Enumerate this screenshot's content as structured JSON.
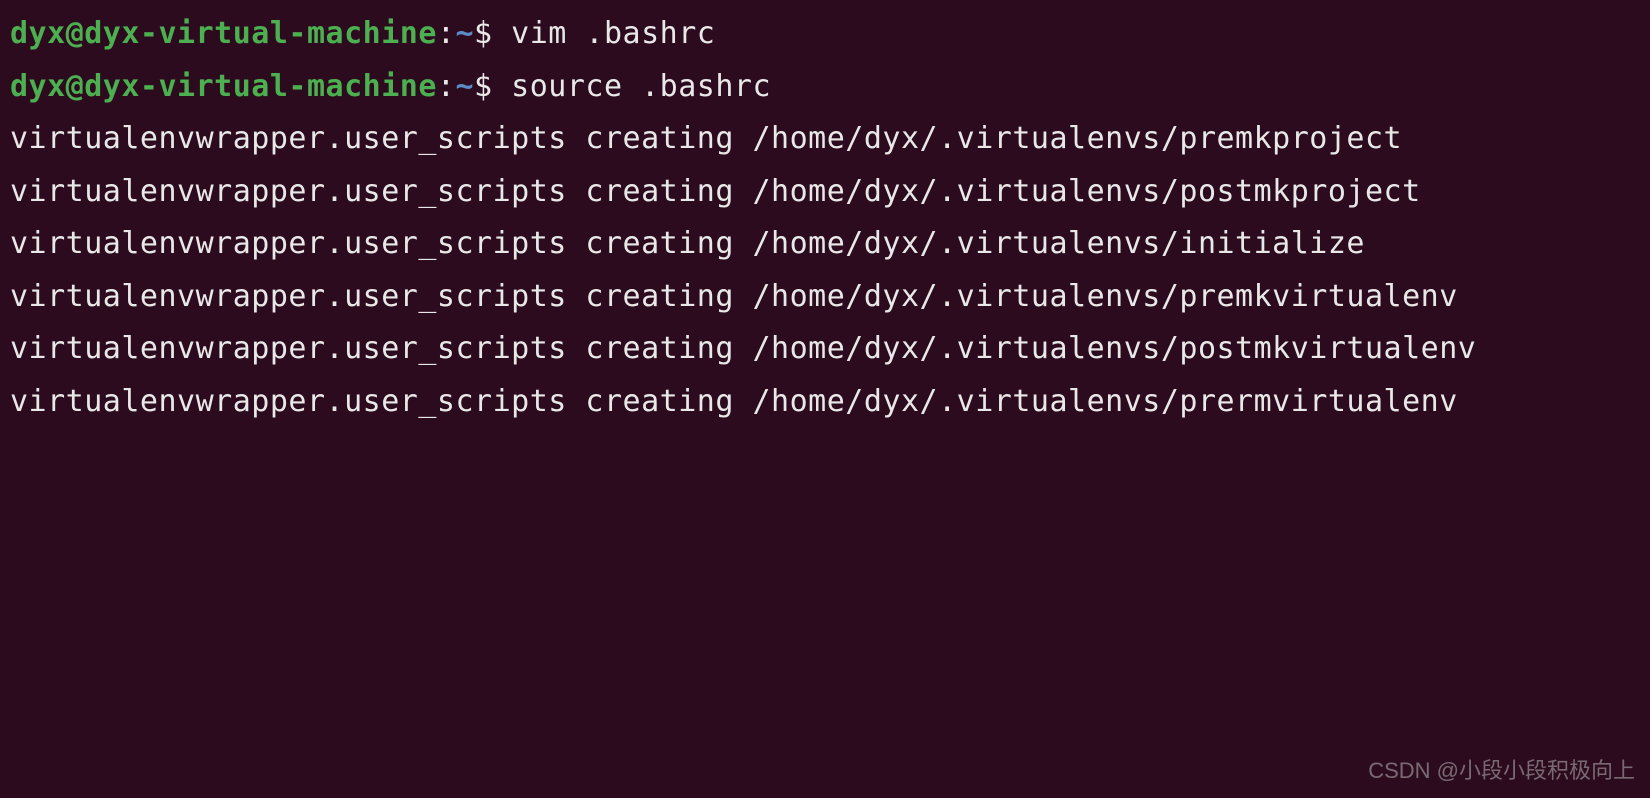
{
  "prompt": {
    "user_host": "dyx@dyx-virtual-machine",
    "colon": ":",
    "path": "~",
    "dollar": "$ "
  },
  "lines": [
    {
      "type": "command",
      "text": "vim .bashrc"
    },
    {
      "type": "command",
      "text": "source .bashrc"
    },
    {
      "type": "output",
      "text": "virtualenvwrapper.user_scripts creating /home/dyx/.virtualenvs/premkproject"
    },
    {
      "type": "output",
      "text": "virtualenvwrapper.user_scripts creating /home/dyx/.virtualenvs/postmkproject"
    },
    {
      "type": "output",
      "text": "virtualenvwrapper.user_scripts creating /home/dyx/.virtualenvs/initialize"
    },
    {
      "type": "output",
      "text": "virtualenvwrapper.user_scripts creating /home/dyx/.virtualenvs/premkvirtualenv"
    },
    {
      "type": "output",
      "text": "virtualenvwrapper.user_scripts creating /home/dyx/.virtualenvs/postmkvirtualenv"
    },
    {
      "type": "output",
      "text": "virtualenvwrapper.user_scripts creating /home/dyx/.virtualenvs/prermvirtualenv"
    }
  ],
  "watermark": "CSDN @小段小段积极向上"
}
